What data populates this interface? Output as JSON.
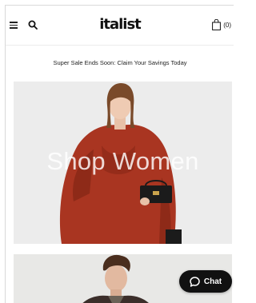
{
  "header": {
    "logo_text": "italist",
    "menu_icon": "hamburger-menu-icon",
    "search_icon": "search-icon",
    "bag_icon": "shopping-bag-icon",
    "bag_count": "(0)"
  },
  "promo": {
    "text": "Super Sale Ends Soon: Claim Your Savings Today"
  },
  "hero": {
    "title": "Shop Women"
  },
  "chat": {
    "label": "Chat",
    "icon": "chat-bubble-icon"
  },
  "colors": {
    "brand": "#111111",
    "hero_background": "#ececec",
    "coat": "#a93521"
  }
}
